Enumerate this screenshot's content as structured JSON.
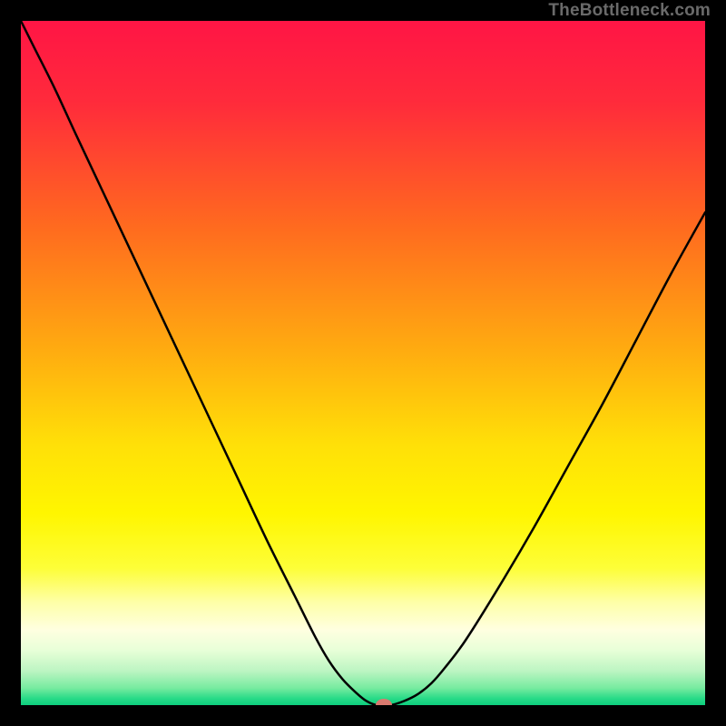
{
  "watermark": "TheBottleneck.com",
  "chart_data": {
    "type": "line",
    "title": "",
    "xlabel": "",
    "ylabel": "",
    "xlim": [
      0,
      100
    ],
    "ylim": [
      0,
      100
    ],
    "grid": false,
    "legend": false,
    "background_gradient_stops": [
      {
        "offset": 0.0,
        "color": "#ff1545"
      },
      {
        "offset": 0.12,
        "color": "#ff2b3b"
      },
      {
        "offset": 0.3,
        "color": "#ff6a1f"
      },
      {
        "offset": 0.48,
        "color": "#ffab10"
      },
      {
        "offset": 0.62,
        "color": "#ffe008"
      },
      {
        "offset": 0.72,
        "color": "#fff600"
      },
      {
        "offset": 0.8,
        "color": "#fdfe38"
      },
      {
        "offset": 0.85,
        "color": "#feffa8"
      },
      {
        "offset": 0.89,
        "color": "#ffffe0"
      },
      {
        "offset": 0.92,
        "color": "#e8ffd8"
      },
      {
        "offset": 0.95,
        "color": "#bcf5c2"
      },
      {
        "offset": 0.975,
        "color": "#77eba0"
      },
      {
        "offset": 0.99,
        "color": "#29db88"
      },
      {
        "offset": 1.0,
        "color": "#0dcd7e"
      }
    ],
    "series": [
      {
        "name": "bottleneck-curve",
        "stroke": "#000000",
        "stroke_width": 2.5,
        "x": [
          0,
          2,
          5,
          8,
          12,
          16,
          20,
          24,
          28,
          32,
          36,
          40,
          43,
          45,
          47,
          49,
          50.5,
          52,
          54,
          56,
          58,
          60,
          62,
          65,
          70,
          75,
          80,
          85,
          90,
          95,
          100
        ],
        "y": [
          100,
          96,
          90,
          83.5,
          75,
          66.5,
          58,
          49.5,
          41,
          32.5,
          24,
          16,
          10,
          6.5,
          3.8,
          1.8,
          0.6,
          0,
          0,
          0.6,
          1.6,
          3.2,
          5.5,
          9.5,
          17.5,
          26,
          35,
          44,
          53.5,
          63,
          72
        ]
      }
    ],
    "marker": {
      "name": "optimal-point",
      "x": 53,
      "y": 0,
      "rx": 9,
      "ry": 7,
      "color": "#d97a6f"
    }
  }
}
